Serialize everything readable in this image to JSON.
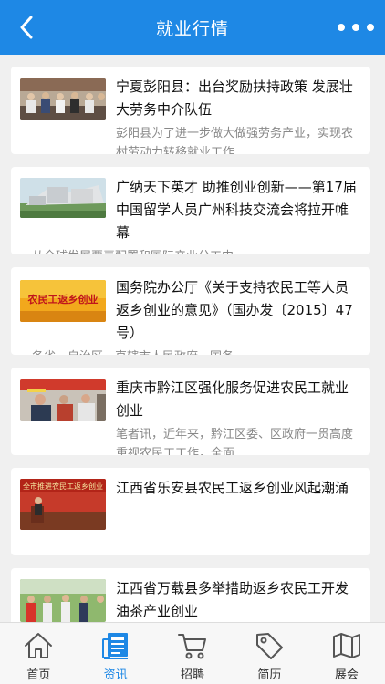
{
  "header": {
    "title": "就业行情",
    "back_icon": "chevron-left-icon",
    "more_icon": "more-horizontal-icon"
  },
  "articles": [
    {
      "title": "宁夏彭阳县：出台奖励扶持政策 发展壮大劳务中介队伍",
      "summary": "彭阳县为了进一步做大做强劳务产业，实现农村劳动力转移就业工作"
    },
    {
      "title": "广纳天下英才 助推创业创新——第17届中国留学人员广州科技交流会将拉开帷幕",
      "summary": "从全球发展要素配置和国际产业分工中"
    },
    {
      "title": "国务院办公厅《关于支持农民工等人员返乡创业的意见》（国办发〔2015〕47号）",
      "summary": "各省、自治区、直辖市人民政府，国务",
      "image_text": "农民工返乡创业"
    },
    {
      "title": "重庆市黔江区强化服务促进农民工就业创业",
      "summary": "笔者讯，近年来，黔江区委、区政府一贯高度重视农民工工作，全面"
    },
    {
      "title": "江西省乐安县农民工返乡创业风起潮涌",
      "summary": "",
      "image_text": "全市推进农民工返乡创业"
    },
    {
      "title": "江西省万载县多举措助返乡农民工开发油茶产业创业",
      "summary": ""
    }
  ],
  "tabbar": {
    "items": [
      {
        "label": "首页",
        "icon": "home-icon",
        "active": false
      },
      {
        "label": "资讯",
        "icon": "news-icon",
        "active": true
      },
      {
        "label": "招聘",
        "icon": "cart-icon",
        "active": false
      },
      {
        "label": "简历",
        "icon": "tag-icon",
        "active": false
      },
      {
        "label": "展会",
        "icon": "map-icon",
        "active": false
      }
    ]
  },
  "colors": {
    "primary": "#1e88e5",
    "background": "#f0f0f0",
    "inactive_icon": "#555555"
  }
}
